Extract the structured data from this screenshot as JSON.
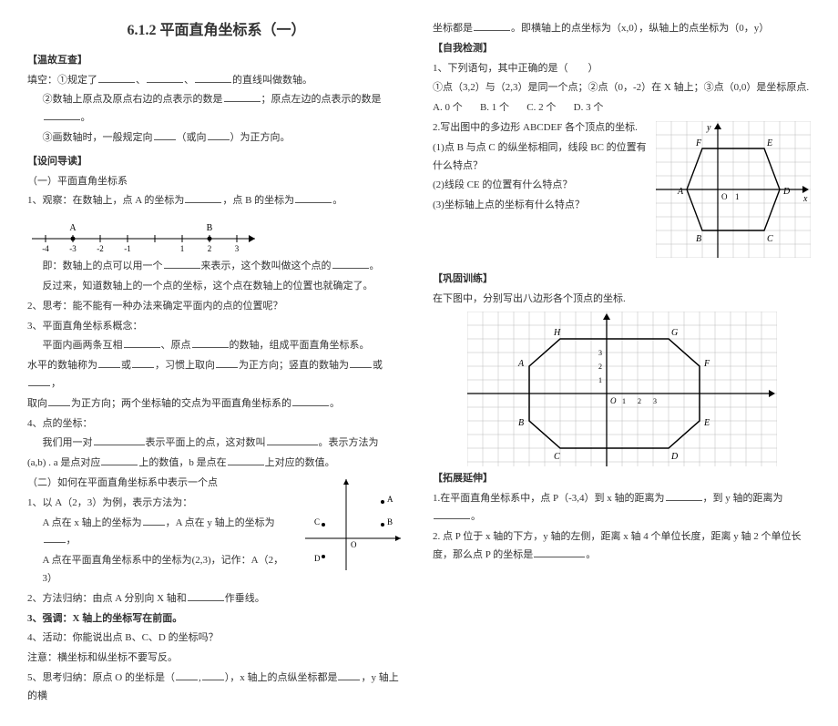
{
  "title": "6.1.2 平面直角坐标系（一）",
  "left": {
    "s1": "【温故互查】",
    "fill_prefix": "填空：",
    "f1": "①规定了",
    "f1b": "、",
    "f1c": "、",
    "f1d": "的直线叫做数轴。",
    "f2": "②数轴上原点及原点右边的点表示的数是",
    "f2b": "；原点左边的点表示的数是",
    "f2c": "。",
    "f3": "③画数轴时，一般规定向",
    "f3b": "（或向",
    "f3c": "）为正方向。",
    "s2": "【设问导读】",
    "s2sub": "（一）平面直角坐标系",
    "q1": "1、观察：在数轴上，点 A 的坐标为",
    "q1b": "，点 B 的坐标为",
    "q1c": "。",
    "line1": "即：数轴上的点可以用一个",
    "line1b": "来表示，这个数叫做这个点的",
    "line1c": "。",
    "line2": "反过来，知道数轴上的一个点的坐标，这个点在数轴上的位置也就确定了。",
    "q2": "2、思考：能不能有一种办法来确定平面内的点的位置呢？",
    "q3": "3、平面直角坐标系概念：",
    "q3a": "平面内画两条互相",
    "q3a2": "、原点",
    "q3a3": "的数轴，组成平面直角坐标系。",
    "q3b": "水平的数轴称为",
    "q3b2": "或",
    "q3b3": "，习惯上取向",
    "q3b4": "为正方向；竖直的数轴为",
    "q3b5": "或",
    "q3b6": "，",
    "q3c": "取向",
    "q3c2": "为正方向；两个坐标轴的交点为平面直角坐标系的",
    "q3c3": "。",
    "q4": "4、点的坐标：",
    "q4a": "我们用一对",
    "q4a2": "表示平面上的点，这对数叫",
    "q4a3": "。表示方法为",
    "q4b": "(a,b) . a 是点对应",
    "q4b2": "上的数值，b 是点在",
    "q4b3": "上对应的数值。",
    "s2sub2": "（二）如何在平面直角坐标系中表示一个点",
    "r1": "1、以 A（2，3）为例，表示方法为：",
    "r1a": "A 点在 x 轴上的坐标为",
    "r1a2": "，A 点在 y 轴上的坐标为",
    "r1a3": "，",
    "r1b": "A 点在平面直角坐标系中的坐标为(2,3)，记作：A（2，3）",
    "r2": "2、方法归纳：由点 A 分别向 X 轴和",
    "r2b": "作垂线。",
    "r3": "3、强调：X 轴上的坐标写在前面。",
    "r4": "4、活动：你能说出点 B、C、D 的坐标吗？",
    "r5": "注意：横坐标和纵坐标不要写反。",
    "r6": "5、思考归纳：原点 O 的坐标是（",
    "r6b": "），x 轴上的点纵坐标都是",
    "r6c": "，y 轴上的横",
    "numberline": {
      "labels_neg": [
        "-4",
        "-3",
        "-2",
        "-1"
      ],
      "labels_pos": [
        "1",
        "2",
        "3"
      ],
      "A": "A",
      "B": "B"
    },
    "plot1": {
      "A": "A",
      "B": "B",
      "C": "C",
      "D": "D",
      "O": "O"
    }
  },
  "right": {
    "top1": "坐标都是",
    "top1b": "。即横轴上的点坐标为（x,0），纵轴上的点坐标为（0，y）",
    "s3": "【自我检测】",
    "t1": "1、下列语句，其中正确的是（　　）",
    "t1opts_line": "①点（3,2）与（2,3）是同一个点；②点（0，-2）在 X 轴上；③点（0,0）是坐标原点.",
    "t1a": "A. 0 个",
    "t1b": "B. 1 个",
    "t1c": "C. 2 个",
    "t1d": "D. 3 个",
    "t2": "2.写出图中的多边形 ABCDEF 各个顶点的坐标.",
    "t2a": "(1)点 B 与点 C 的纵坐标相同，线段 BC 的位置有什么特点？",
    "t2b": "(2)线段 CE 的位置有什么特点？",
    "t2c": "(3)坐标轴上点的坐标有什么特点？",
    "s4": "【巩固训练】",
    "gx": "在下图中，分别写出八边形各个顶点的坐标.",
    "s5": "【拓展延伸】",
    "e1": "1.在平面直角坐标系中，点 P（-3,4）到 x 轴的距离为",
    "e1b": "，到 y 轴的距离为",
    "e1c": "。",
    "e2": "2. 点 P 位于 x 轴的下方，y 轴的左侧，距离 x 轴 4 个单位长度，距离 y 轴 2 个单位长度，那么点 P 的坐标是",
    "e2b": "。",
    "hex": {
      "A": "A",
      "B": "B",
      "C": "C",
      "D": "D",
      "E": "E",
      "F": "F",
      "O": "O",
      "one": "1",
      "x": "x",
      "y": "y"
    },
    "oct": {
      "A": "A",
      "B": "B",
      "C": "C",
      "D": "D",
      "E": "E",
      "F": "F",
      "G": "G",
      "H": "H",
      "O": "O",
      "nums": [
        "1",
        "2",
        "3"
      ],
      "ynums": [
        "1",
        "2",
        "3"
      ]
    }
  }
}
